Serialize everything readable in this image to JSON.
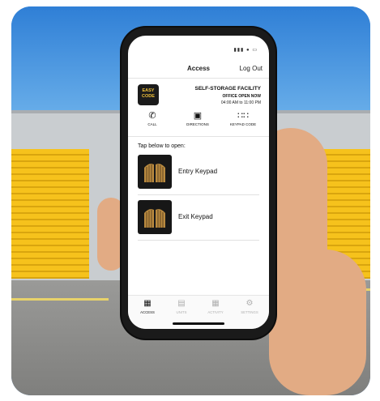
{
  "status_bar": {
    "signal": "▮▮▮ ● ▭"
  },
  "header": {
    "title": "Access",
    "logout_label": "Log Out"
  },
  "facility": {
    "logo_text_1": "EASY",
    "logo_text_2": "CODE",
    "name": "SELF-STORAGE FACILITY",
    "status": "OFFICE OPEN NOW",
    "hours": "04:00 AM to 11:00 PM"
  },
  "quick_actions": [
    {
      "label": "CALL",
      "icon": "phone-icon"
    },
    {
      "label": "DIRECTIONS",
      "icon": "map-icon"
    },
    {
      "label": "KEYPAD CODE",
      "icon": "keypad-icon"
    }
  ],
  "main": {
    "prompt": "Tap below to open:",
    "keypads": [
      {
        "label": "Entry Keypad",
        "icon": "gate-icon"
      },
      {
        "label": "Exit Keypad",
        "icon": "gate-icon"
      }
    ]
  },
  "tabs": [
    {
      "label": "ACCESS",
      "icon": "access-icon",
      "active": true
    },
    {
      "label": "UNITS",
      "icon": "units-icon",
      "active": false
    },
    {
      "label": "ACTIVITY",
      "icon": "activity-icon",
      "active": false
    },
    {
      "label": "SETTINGS",
      "icon": "settings-icon",
      "active": false
    }
  ],
  "colors": {
    "accent": "#f3c33a",
    "dark": "#171717",
    "inactive_tab": "#b0b0b0"
  }
}
